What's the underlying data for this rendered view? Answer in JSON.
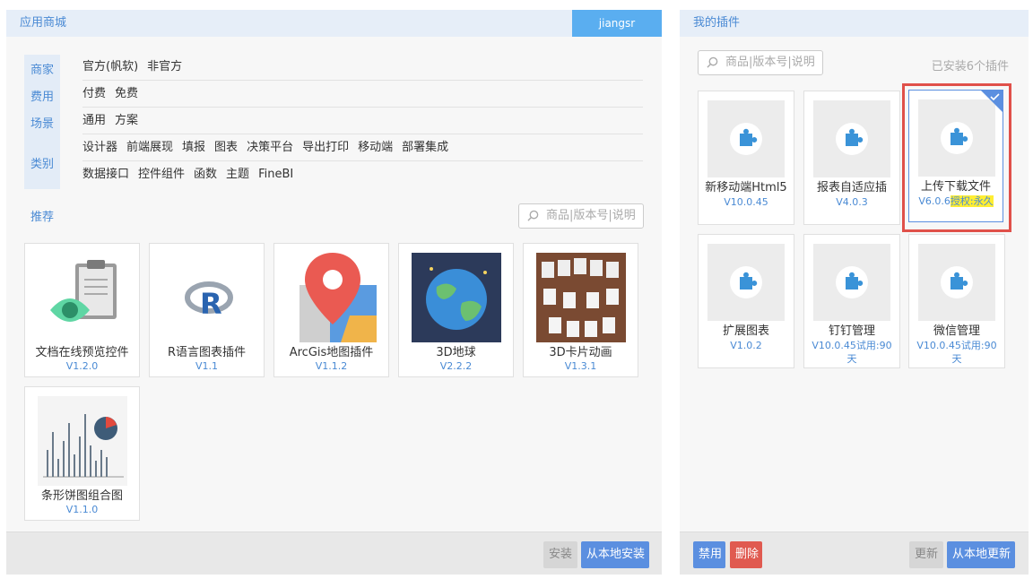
{
  "store": {
    "title": "应用商城",
    "user": "jiangsr",
    "filters": [
      {
        "label": "商家",
        "options": [
          "官方(帆软)",
          "非官方"
        ]
      },
      {
        "label": "费用",
        "options": [
          "付费",
          "免费"
        ]
      },
      {
        "label": "场景",
        "options": [
          "通用",
          "方案"
        ]
      },
      {
        "label": "类别",
        "options": [
          "设计器",
          "前端展现",
          "填报",
          "图表",
          "决策平台",
          "导出打印",
          "移动端",
          "部署集成"
        ],
        "options2": [
          "数据接口",
          "控件组件",
          "函数",
          "主题",
          "FineBI"
        ]
      }
    ],
    "recommend_title": "推荐",
    "search_placeholder": "商品|版本号|说明",
    "cards": [
      {
        "name": "文档在线预览控件",
        "version": "V1.2.0",
        "icon": "document-eye-icon"
      },
      {
        "name": "R语言图表插件",
        "version": "V1.1",
        "icon": "r-language-icon"
      },
      {
        "name": "ArcGis地图插件",
        "version": "V1.1.2",
        "icon": "map-pin-icon"
      },
      {
        "name": "3D地球",
        "version": "V2.2.2",
        "icon": "globe-icon"
      },
      {
        "name": "3D卡片动画",
        "version": "V1.3.1",
        "icon": "card-carousel-icon"
      },
      {
        "name": "条形饼图组合图",
        "version": "V1.1.0",
        "icon": "bar-pie-chart-icon"
      }
    ],
    "footer": {
      "install": "安装",
      "install_local": "从本地安装"
    }
  },
  "plugins": {
    "title": "我的插件",
    "search_placeholder": "商品|版本号|说明",
    "installed_count": "已安装6个插件",
    "items": [
      {
        "name": "新移动端Html5",
        "version": "V10.0.45",
        "icon": "puzzle-icon"
      },
      {
        "name": "报表自适应插",
        "version": "V4.0.3",
        "icon": "puzzle-icon"
      },
      {
        "name": "上传下载文件",
        "version_plain": "V6.0.6",
        "version_hl": "授权:永久",
        "icon": "puzzle-icon",
        "selected": true
      },
      {
        "name": "扩展图表",
        "version": "V1.0.2",
        "icon": "puzzle-icon"
      },
      {
        "name": "钉钉管理",
        "version": "V10.0.45试用:90天",
        "icon": "puzzle-icon"
      },
      {
        "name": "微信管理",
        "version": "V10.0.45试用:90天",
        "icon": "puzzle-icon"
      }
    ],
    "footer": {
      "disable": "禁用",
      "delete": "删除",
      "update": "更新",
      "update_local": "从本地更新"
    }
  },
  "colors": {
    "accent": "#4a8ad4",
    "primary_button": "#5b8fe0",
    "danger_button": "#e05a50",
    "selection_border": "#e0504a",
    "highlight": "#ffee33"
  }
}
